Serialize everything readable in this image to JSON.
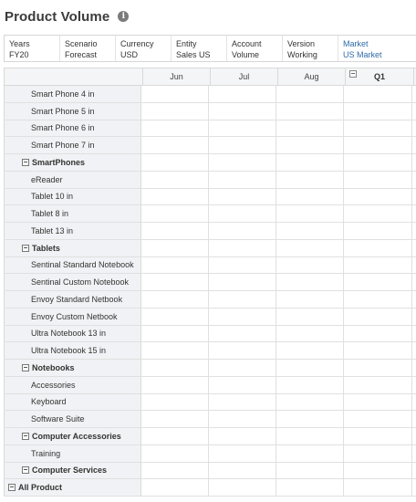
{
  "page": {
    "title": "Product Volume",
    "info_icon": "info-icon"
  },
  "pov": [
    {
      "label": "Years",
      "value": "FY20"
    },
    {
      "label": "Scenario",
      "value": "Forecast"
    },
    {
      "label": "Currency",
      "value": "USD"
    },
    {
      "label": "Entity",
      "value": "Sales US"
    },
    {
      "label": "Account",
      "value": "Volume"
    },
    {
      "label": "Version",
      "value": "Working"
    },
    {
      "label": "Market",
      "value": "US Market"
    }
  ],
  "columns": [
    "Jun",
    "Jul",
    "Aug",
    "Q1"
  ],
  "rows": [
    {
      "label": "Smart Phone 4 in",
      "level": 2
    },
    {
      "label": "Smart Phone 5 in",
      "level": 2
    },
    {
      "label": "Smart Phone 6 in",
      "level": 2
    },
    {
      "label": "Smart Phone 7 in",
      "level": 2
    },
    {
      "label": "SmartPhones",
      "level": 1
    },
    {
      "label": "eReader",
      "level": 2
    },
    {
      "label": "Tablet 10 in",
      "level": 2
    },
    {
      "label": "Tablet 8 in",
      "level": 2
    },
    {
      "label": "Tablet 13 in",
      "level": 2
    },
    {
      "label": "Tablets",
      "level": 1
    },
    {
      "label": "Sentinal Standard Notebook",
      "level": 2
    },
    {
      "label": "Sentinal Custom Notebook",
      "level": 2
    },
    {
      "label": "Envoy Standard Netbook",
      "level": 2
    },
    {
      "label": "Envoy Custom Netbook",
      "level": 2
    },
    {
      "label": "Ultra Notebook 13 in",
      "level": 2
    },
    {
      "label": "Ultra Notebook 15 in",
      "level": 2
    },
    {
      "label": "Notebooks",
      "level": 1
    },
    {
      "label": "Accessories",
      "level": 2
    },
    {
      "label": "Keyboard",
      "level": 2
    },
    {
      "label": "Software Suite",
      "level": 2
    },
    {
      "label": "Computer Accessories",
      "level": 1
    },
    {
      "label": "Training",
      "level": 2
    },
    {
      "label": "Computer Services",
      "level": 1
    },
    {
      "label": "All Product",
      "level": 0
    }
  ]
}
